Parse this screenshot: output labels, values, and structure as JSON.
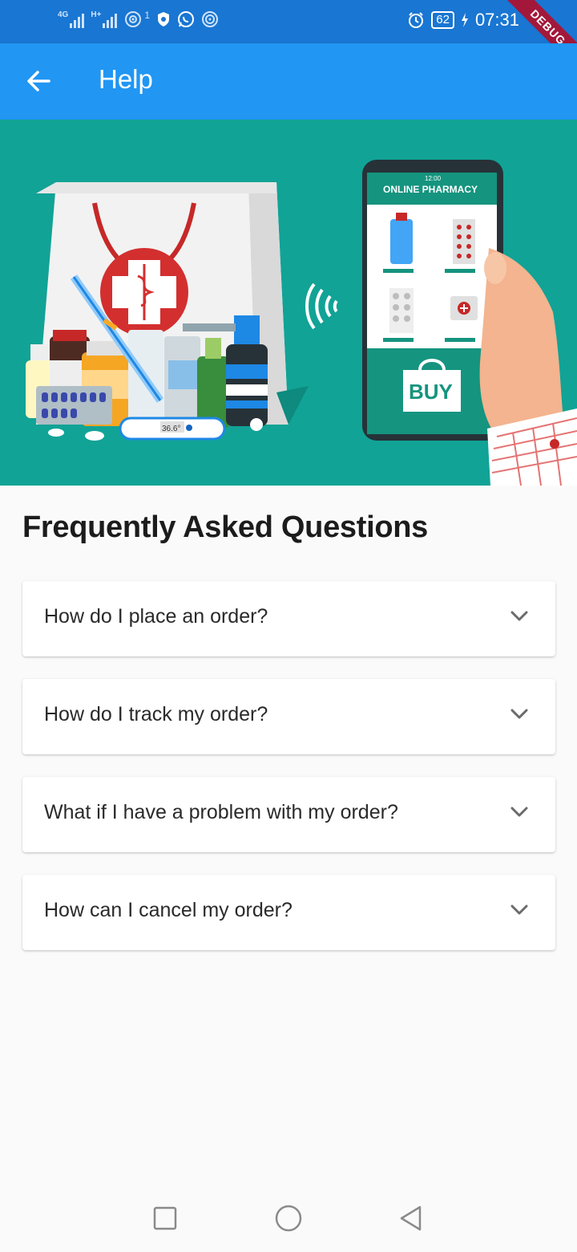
{
  "status_bar": {
    "network_left": "4G",
    "network_right": "H+",
    "sim_badge": "1",
    "battery": "62",
    "time": "07:31"
  },
  "debug_banner": "DEBUG",
  "app_bar": {
    "title": "Help"
  },
  "hero": {
    "phone_time": "12:00",
    "pharmacy_label": "ONLINE PHARMACY",
    "buy_label": "BUY",
    "thermometer_reading": "36.6°"
  },
  "faq": {
    "heading": "Frequently Asked Questions",
    "items": [
      {
        "question": "How do I place an order?"
      },
      {
        "question": "How do I track my order?"
      },
      {
        "question": "What if I have a problem with my order?"
      },
      {
        "question": "How can I cancel my order?"
      }
    ]
  },
  "colors": {
    "status_bar": "#1976d2",
    "app_bar": "#2196f3",
    "hero_bg": "#11a396",
    "debug": "#a3183a"
  }
}
